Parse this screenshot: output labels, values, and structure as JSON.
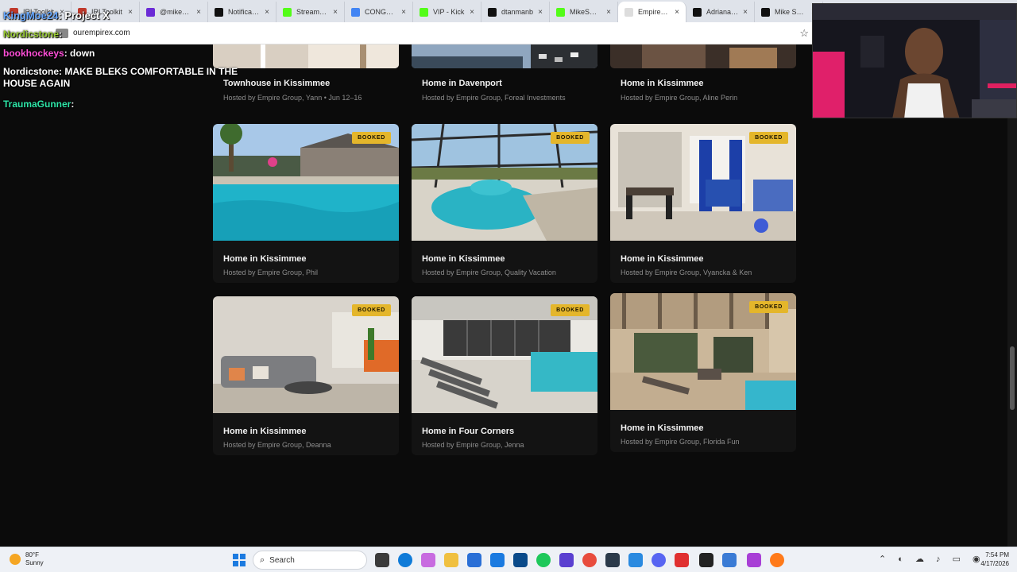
{
  "browser": {
    "tabs": [
      {
        "label": "IRLToolkit",
        "color": "#c0392b"
      },
      {
        "label": "IRLToolkit",
        "color": "#c0392b"
      },
      {
        "label": "@mikesmallsjr",
        "color": "#6b2bd6"
      },
      {
        "label": "Notifications",
        "color": "#111111"
      },
      {
        "label": "Stream - Kick",
        "color": "#53fc18"
      },
      {
        "label": "CONGRADULATIONS",
        "color": "#4285f4"
      },
      {
        "label": "VIP - Kick",
        "color": "#53fc18"
      },
      {
        "label": "dtanmanb",
        "color": "#111111"
      },
      {
        "label": "MikeSmalls",
        "color": "#53fc18"
      },
      {
        "label": "EmpireX –",
        "color": "#dddddd"
      },
      {
        "label": "Adrianah L",
        "color": "#111111"
      },
      {
        "label": "Mike Smalls",
        "color": "#111111"
      }
    ],
    "active_tab_index": 9,
    "url": "ourempirex.com"
  },
  "chat": [
    {
      "user": "KingMoe24",
      "user_color": "#6aa9ff",
      "message": "Project X"
    },
    {
      "user": "Nordicstone",
      "user_color": "#9acd32",
      "message": ""
    },
    {
      "user": "bookhockeys",
      "user_color": "#ff4fd8",
      "message": "down"
    },
    {
      "user": "Nordicstone",
      "user_color": "#ffffff",
      "message": "MAKE BLEKS COMFORTABLE IN THE HOUSE AGAIN"
    },
    {
      "user": "TraumaGunner",
      "user_color": "#2ee6a8",
      "message": ""
    }
  ],
  "top_row": [
    {
      "title": "Townhouse in Kissimmee",
      "host": "Hosted by Empire Group, Yann • Jun 12–16"
    },
    {
      "title": "Home in Davenport",
      "host": "Hosted by Empire Group, Foreal Investments"
    },
    {
      "title": "Home in Kissimmee",
      "host": "Hosted by Empire Group, Aline Perin"
    }
  ],
  "listings": [
    {
      "title": "Home in Kissimmee",
      "host": "Hosted by Empire Group, Phil",
      "badge": "BOOKED"
    },
    {
      "title": "Home in Kissimmee",
      "host": "Hosted by Empire Group, Quality Vacation",
      "badge": "BOOKED"
    },
    {
      "title": "Home in Kissimmee",
      "host": "Hosted by Empire Group, Vyancka & Ken",
      "badge": "BOOKED"
    },
    {
      "title": "Home in Kissimmee",
      "host": "Hosted by Empire Group, Deanna",
      "badge": "BOOKED"
    },
    {
      "title": "Home in Four Corners",
      "host": "Hosted by Empire Group, Jenna",
      "badge": "BOOKED"
    },
    {
      "title": "Home in Kissimmee",
      "host": "Hosted by Empire Group, Florida Fun",
      "badge": "BOOKED"
    }
  ],
  "taskbar": {
    "weather_temp": "80°F",
    "weather_desc": "Sunny",
    "search_label": "Search",
    "time": "7:54 PM",
    "date": "4/17/2026"
  }
}
